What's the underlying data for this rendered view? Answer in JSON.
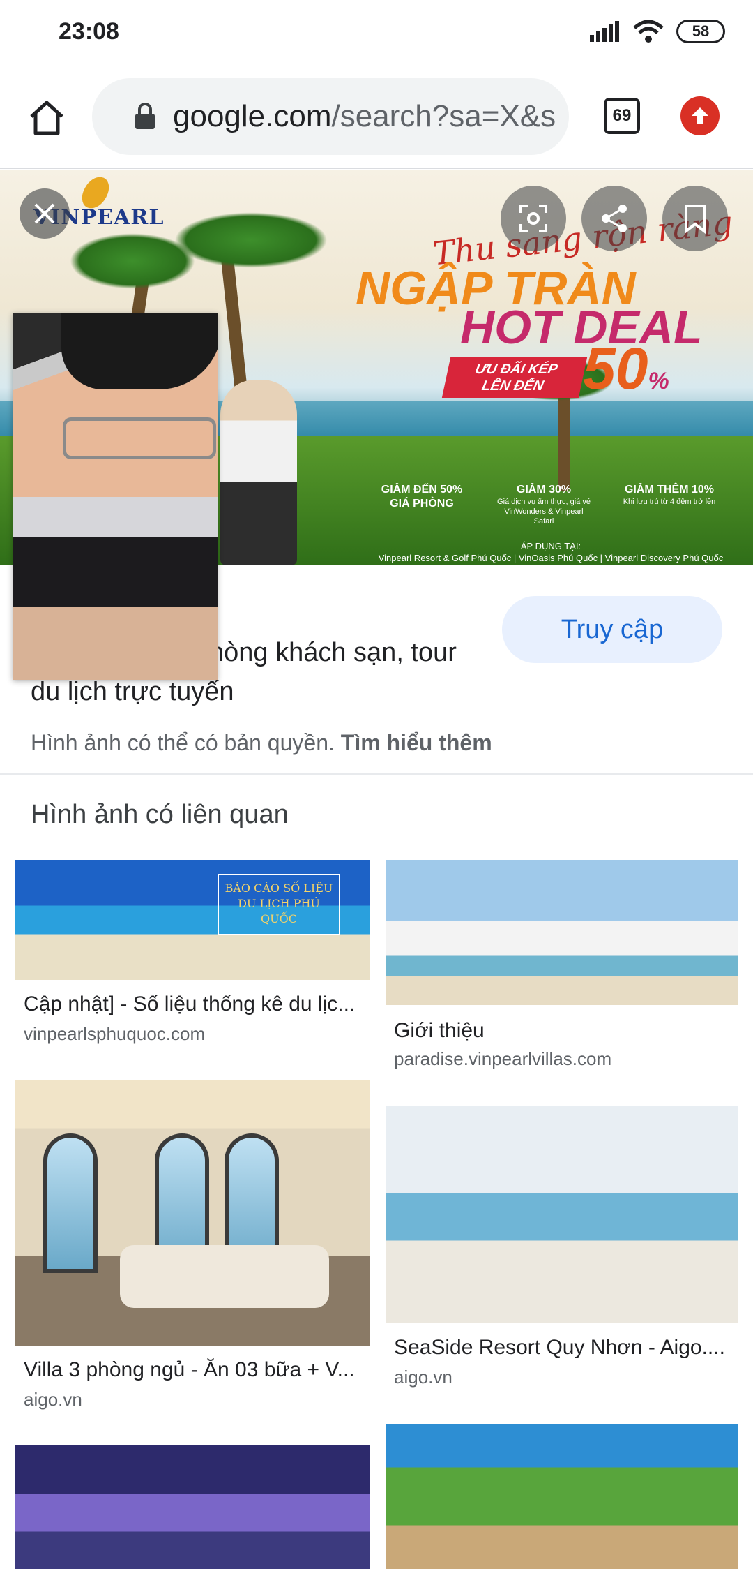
{
  "status": {
    "time": "23:08",
    "battery": "58"
  },
  "browser": {
    "url_host": "google.com",
    "url_rest": "/search?sa=X&s",
    "tab_count": "69"
  },
  "hero": {
    "logo": "VINPEARL",
    "slogan": "Thu sang rộn ràng",
    "headline_1": "NGẬP TRÀN",
    "headline_2": "HOT DEAL",
    "offer_line_1": "ƯU ĐÃI KÉP",
    "offer_line_2": "LÊN ĐẾN",
    "percent": "50",
    "percent_sign": "%",
    "deals": [
      {
        "title": "GIẢM ĐẾN 50%",
        "subtitle": "GIÁ PHÒNG"
      },
      {
        "title": "GIẢM 30%",
        "subtitle": "Giá dịch vụ ẩm thực, giá vé VinWonders & Vinpearl Safari"
      },
      {
        "title": "GIẢM THÊM 10%",
        "subtitle": "Khi lưu trú từ 4 đêm trở lên"
      }
    ],
    "apply_label": "ÁP DỤNG TẠI:",
    "apply_places": "Vinpearl Resort & Golf Phú Quốc | VinOasis Phú Quốc | Vinpearl Discovery Phú Quốc"
  },
  "info": {
    "visit_label": "Truy cập",
    "title_line_1": "hòng khách sạn, tour",
    "title_line_2": "du lịch trực tuyến",
    "copyright_text": "Hình ảnh có thể có bản quyền.",
    "learn_more": "Tìm hiểu thêm"
  },
  "related": {
    "heading": "Hình ảnh có liên quan",
    "thumb_sign": "BÁO CÁO SỐ LIỆU DU LỊCH PHÚ QUỐC",
    "items": [
      {
        "caption": "Cập nhật] - Số liệu thống kê du lịc...",
        "source": "vinpearlsphuquoc.com"
      },
      {
        "caption": "Giới thiệu",
        "source": "paradise.vinpearlvillas.com"
      },
      {
        "caption": "Villa 3 phòng ngủ - Ăn 03 bữa + V...",
        "source": "aigo.vn"
      },
      {
        "caption": "SeaSide Resort Quy Nhơn - Aigo....",
        "source": "aigo.vn"
      }
    ]
  }
}
